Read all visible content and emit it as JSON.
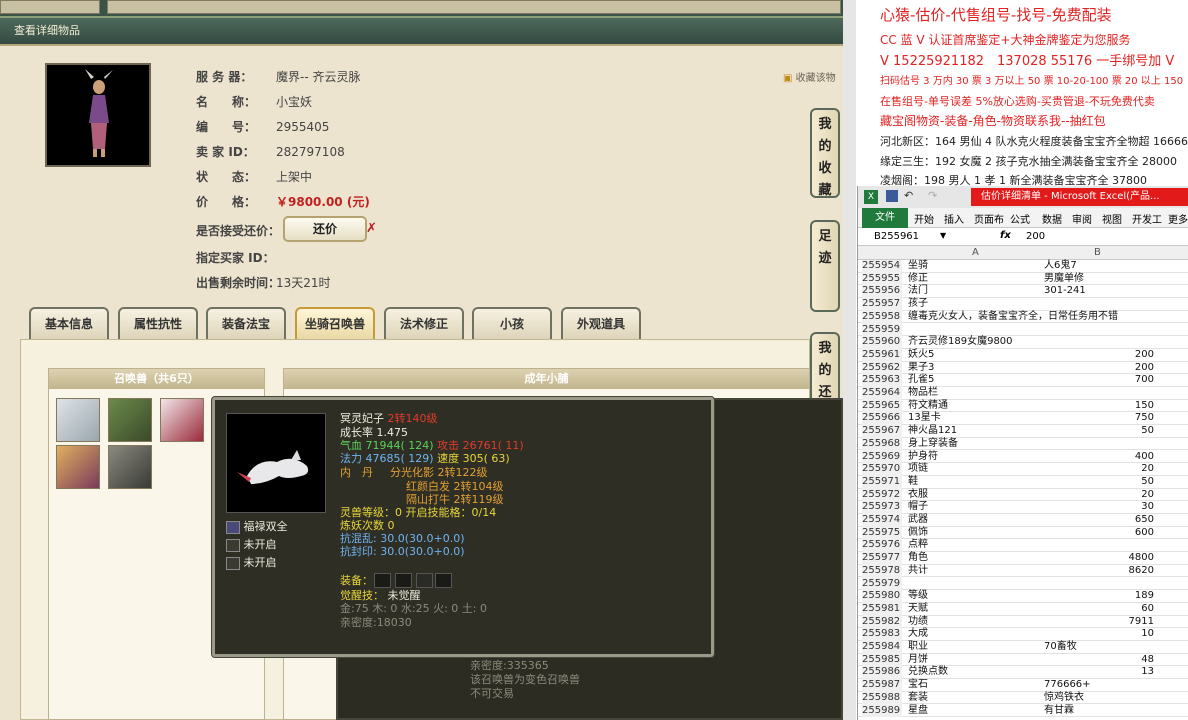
{
  "game": {
    "window_title": "查看详细物品",
    "fields": [
      {
        "label": "服 务 器：",
        "value": "魔界-- 齐云灵脉"
      },
      {
        "label": "名　　称：",
        "value": "小宝妖"
      },
      {
        "label": "编　　号：",
        "value": "2955405"
      },
      {
        "label": "卖 家 ID：",
        "value": "282797108"
      },
      {
        "label": "状　　态：",
        "value": "上架中"
      },
      {
        "label": "价　　格：",
        "value": "￥9800.00 (元)"
      },
      {
        "label": "是否接受还价：",
        "value": ""
      },
      {
        "label": "指定买家 ID：",
        "value": ""
      },
      {
        "label": "出售剩余时间：",
        "value": "13天21时"
      }
    ],
    "counter_offer_label": "还价",
    "counter_x": "✗",
    "favorite_link": "收藏该物",
    "side_buttons": [
      "我的收藏",
      "足迹",
      "我的还价"
    ],
    "tabs": [
      "基本信息",
      "属性抗性",
      "装备法宝",
      "坐骑召唤兽",
      "法术修正",
      "小孩",
      "外观道具"
    ],
    "pet_list_header": "召唤兽（共6只）",
    "detail_header": "成年小脯",
    "bg_text": [
      "亲密度:335365",
      "该召唤兽为变色召唤兽",
      "不可交易"
    ],
    "tooltip": {
      "name": "冥灵妃子",
      "name_level": "2转140级",
      "growth": "成长率 1.475",
      "qixue_label": "气血",
      "qixue_val": "71944( 124)",
      "gongji_label": "攻击",
      "gongji_val": "26761( 11)",
      "fali_label": "法力",
      "fali_val": "47685( 129)",
      "sudu_label": "速度",
      "sudu_val": "305( 63)",
      "neidan_label": "内　丹",
      "neidan": [
        {
          "name": "分光化影",
          "level": "2转122级"
        },
        {
          "name": "红颜白发",
          "level": "2转104级"
        },
        {
          "name": "隔山打牛",
          "level": "2转119级"
        }
      ],
      "lingshou": "灵兽等级：0 开启技能格：0/14",
      "lianyao": "炼妖次数 0",
      "kanghunluan": "抗混乱: 30.0(30.0+0.0)",
      "kangfengyin": "抗封印: 30.0(30.0+0.0)",
      "skills": [
        "福禄双全",
        "未开启",
        "未开启"
      ],
      "equip_label": "装备：",
      "awaken_label": "觉醒技：",
      "awaken_val": "未觉醒",
      "elements": "金:75 木: 0 水:25 火: 0 土: 0",
      "intimacy": "亲密度:18030"
    }
  },
  "ad": {
    "lines": [
      {
        "text": "心猿-估价-代售组号-找号-免费配装",
        "color": "#e32222"
      },
      {
        "text": "CC 蓝 V 认证首席鉴定+大神金牌鉴定为您服务",
        "color": "#e32222"
      },
      {
        "text": "V 15225921182　137028 55176 一手绑号加 V",
        "color": "#e32222"
      },
      {
        "text": "扫码估号 3 万内 30 票 3 万以上 50 票 10-20-100 票 20 以上 150",
        "color": "#e32222"
      },
      {
        "text": "在售组号-单号误差 5%放心选购-买贵管退-不玩免费代卖",
        "color": "#e32222"
      },
      {
        "text": "藏宝阁物资-装备-角色-物资联系我--抽红包",
        "color": "#e32222"
      },
      {
        "text": "河北新区：164 男仙 4 队水克火程度装备宝宝齐全物超 16666",
        "color": "#222222"
      },
      {
        "text": "缘定三生：192 女魔 2 孩子克水抽全满装备宝宝齐全 28000",
        "color": "#222222"
      },
      {
        "text": "凌烟阁：198 男人 1 孝 1 新全满装备宝宝齐全 37800",
        "color": "#222222"
      }
    ]
  },
  "excel": {
    "title": "估价详细清单 - Microsoft Excel(产品...",
    "file_label": "文件",
    "ribbon": [
      "开始",
      "插入",
      "页面布",
      "公式",
      "数据",
      "审阅",
      "视图",
      "开发工",
      "更多"
    ],
    "namebox": "B255961",
    "fx": "fx",
    "formula": "200",
    "col_a": "A",
    "col_b": "B",
    "rows": [
      {
        "n": "255954",
        "a": "坐骑",
        "b": "人6鬼7",
        "num": false
      },
      {
        "n": "255955",
        "a": "修正",
        "b": "男魔单修",
        "num": false
      },
      {
        "n": "255956",
        "a": "法门",
        "b": "301-241",
        "num": false
      },
      {
        "n": "255957",
        "a": "孩子",
        "b": "",
        "num": false
      },
      {
        "n": "255958",
        "a": "缠毒克火女人，装备宝宝齐全，日常任务用不错",
        "b": "",
        "num": false
      },
      {
        "n": "255959",
        "a": "",
        "b": "",
        "num": false
      },
      {
        "n": "255960",
        "a": "齐云灵修189女魔9800",
        "b": "",
        "num": false
      },
      {
        "n": "255961",
        "a": "妖火5",
        "b": "200",
        "num": true
      },
      {
        "n": "255962",
        "a": "果子3",
        "b": "200",
        "num": true
      },
      {
        "n": "255963",
        "a": "孔雀5",
        "b": "700",
        "num": true
      },
      {
        "n": "255964",
        "a": "物品栏",
        "b": "",
        "num": false
      },
      {
        "n": "255965",
        "a": "符文精通",
        "b": "150",
        "num": true
      },
      {
        "n": "255966",
        "a": "13星卡",
        "b": "750",
        "num": true
      },
      {
        "n": "255967",
        "a": "神火晶121",
        "b": "50",
        "num": true
      },
      {
        "n": "255968",
        "a": "身上穿装备",
        "b": "",
        "num": false
      },
      {
        "n": "255969",
        "a": "护身符",
        "b": "400",
        "num": true
      },
      {
        "n": "255970",
        "a": "项链",
        "b": "20",
        "num": true
      },
      {
        "n": "255971",
        "a": "鞋",
        "b": "50",
        "num": true
      },
      {
        "n": "255972",
        "a": "衣服",
        "b": "20",
        "num": true
      },
      {
        "n": "255973",
        "a": "帽子",
        "b": "30",
        "num": true
      },
      {
        "n": "255974",
        "a": "武器",
        "b": "650",
        "num": true
      },
      {
        "n": "255975",
        "a": "佩饰",
        "b": "600",
        "num": true
      },
      {
        "n": "255976",
        "a": "点粹",
        "b": "",
        "num": false
      },
      {
        "n": "255977",
        "a": "角色",
        "b": "4800",
        "num": true
      },
      {
        "n": "255978",
        "a": "共计",
        "b": "8620",
        "num": true
      },
      {
        "n": "255979",
        "a": "",
        "b": "",
        "num": false
      },
      {
        "n": "255980",
        "a": "等级",
        "b": "189",
        "num": true
      },
      {
        "n": "255981",
        "a": "天赋",
        "b": "60",
        "num": true
      },
      {
        "n": "255982",
        "a": "功绩",
        "b": "7911",
        "num": true
      },
      {
        "n": "255983",
        "a": "大成",
        "b": "10",
        "num": true
      },
      {
        "n": "255984",
        "a": "职业",
        "b": "70畜牧",
        "num": false
      },
      {
        "n": "255985",
        "a": "月饼",
        "b": "48",
        "num": true
      },
      {
        "n": "255986",
        "a": "兑换点数",
        "b": "13",
        "num": true
      },
      {
        "n": "255987",
        "a": "宝石",
        "b": "776666+",
        "num": false
      },
      {
        "n": "255988",
        "a": "套装",
        "b": "惊鸡铁衣",
        "num": false
      },
      {
        "n": "255989",
        "a": "星盘",
        "b": "有甘霖",
        "num": false
      }
    ]
  }
}
